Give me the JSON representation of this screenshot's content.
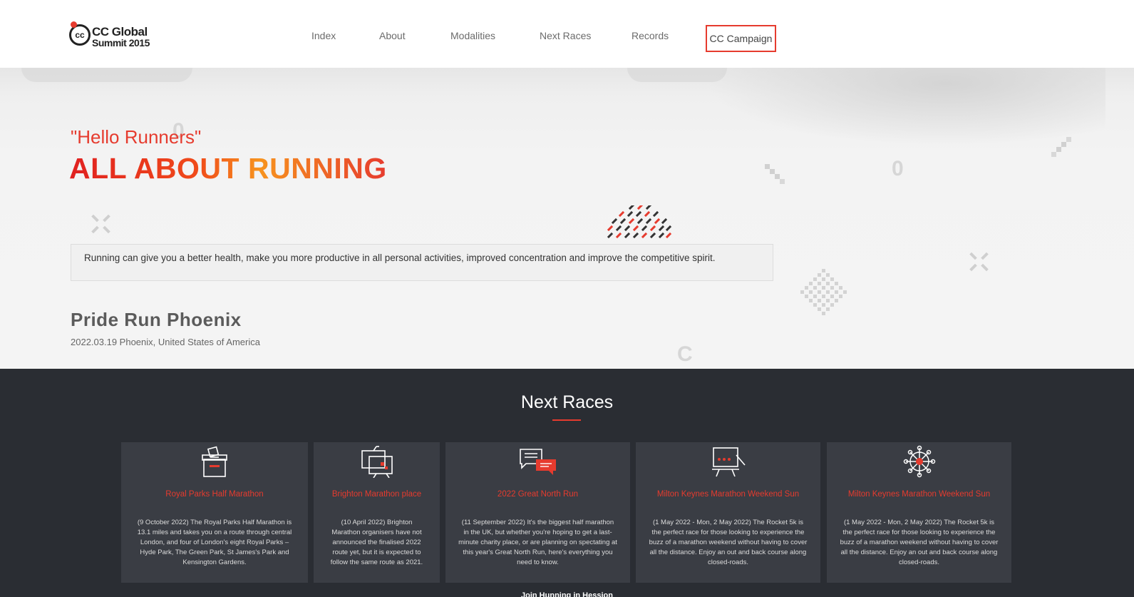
{
  "header": {
    "logo": {
      "line1": "CC Global",
      "line2": "Summit 2015",
      "mark": "cc"
    },
    "nav": [
      {
        "label": "Index"
      },
      {
        "label": "About"
      },
      {
        "label": "Modalities"
      },
      {
        "label": "Next Races"
      },
      {
        "label": "Records"
      }
    ],
    "campaign_label": "CC Campaign"
  },
  "hero": {
    "greeting": "\"Hello Runners\"",
    "title": "ALL ABOUT RUNNING",
    "description": "Running can give you a better health, make you more productive in all personal activities, improved concentration and improve the competitive spirit.",
    "featured_race": {
      "name": "Pride Run Phoenix",
      "meta": "2022.03.19 Phoenix, United States of America"
    }
  },
  "next_races": {
    "title": "Next Races",
    "cards": [
      {
        "icon": "ballot-box-icon",
        "title": "Royal Parks Half Marathon",
        "text": "(9 October 2022) The Royal Parks Half Marathon is 13.1 miles and takes you on a route through central London, and four of London's eight Royal Parks – Hyde Park, The Green Park, St James's Park and Kensington Gardens."
      },
      {
        "icon": "presentation-board-icon",
        "title": "Brighton Marathon place",
        "text": "(10 April 2022) Brighton Marathon organisers have not announced the finalised 2022 route yet, but it is expected to follow the same route as 2021."
      },
      {
        "icon": "chat-bubbles-icon",
        "title": "2022 Great North Run",
        "text": "(11 September 2022) It's the biggest half marathon in the UK, but whether you're hoping to get a last-minute charity place, or are planning on spectating at this year's Great North Run, here's everything you need to know."
      },
      {
        "icon": "easel-chart-icon",
        "title": "Milton Keynes Marathon Weekend Sun",
        "text": "(1 May 2022 - Mon, 2 May 2022) The Rocket 5k is the perfect race for those looking to experience the buzz of a marathon weekend without having to cover all the distance. Enjoy an out and back course along closed-roads."
      },
      {
        "icon": "network-hub-icon",
        "title": "Milton Keynes Marathon Weekend Sun",
        "text": "(1 May 2022 - Mon, 2 May 2022) The Rocket 5k is the perfect race for those looking to experience the buzz of a marathon weekend without having to cover all the distance. Enjoy an out and back course along closed-roads."
      }
    ],
    "footer_partial": "Join Hunning in Hession"
  },
  "colors": {
    "accent": "#e63b2e",
    "dark_section": "#2a2d33",
    "card": "#3a3d44"
  }
}
